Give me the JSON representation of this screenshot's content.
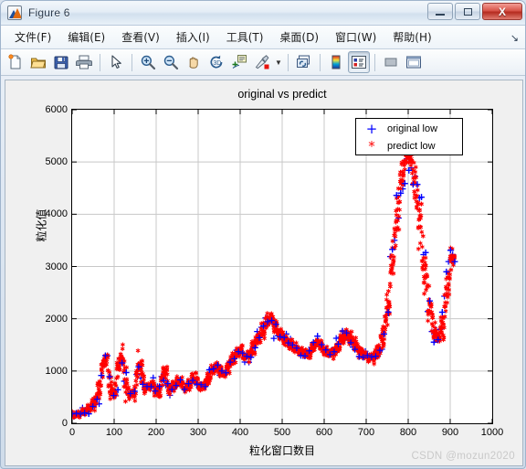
{
  "window": {
    "title": "Figure 6",
    "icon": "matlab-membrane-icon",
    "controls": {
      "minimize": "–",
      "maximize": "□",
      "close": "X"
    }
  },
  "menu": {
    "items": [
      {
        "label": "文件(F)",
        "name": "menu-file"
      },
      {
        "label": "编辑(E)",
        "name": "menu-edit"
      },
      {
        "label": "查看(V)",
        "name": "menu-view"
      },
      {
        "label": "插入(I)",
        "name": "menu-insert"
      },
      {
        "label": "工具(T)",
        "name": "menu-tools"
      },
      {
        "label": "桌面(D)",
        "name": "menu-desktop"
      },
      {
        "label": "窗口(W)",
        "name": "menu-window"
      },
      {
        "label": "帮助(H)",
        "name": "menu-help"
      }
    ],
    "overflow": "↘"
  },
  "toolbar": {
    "buttons": [
      "new-figure-icon",
      "open-file-icon",
      "save-figure-icon",
      "print-figure-icon",
      "pointer-icon",
      "zoom-in-icon",
      "zoom-out-icon",
      "pan-icon",
      "rotate-3d-icon",
      "data-cursor-icon",
      "brush-icon",
      "brush-dropdown-arrow",
      "link-plot-icon",
      "colorbar-icon",
      "legend-icon",
      "hide-plot-tools-icon",
      "show-plot-tools-icon"
    ],
    "pressed": "legend-icon"
  },
  "watermark": "CSDN @mozun2020",
  "chart_data": {
    "type": "scatter",
    "title": "original vs predict",
    "xlabel": "粒化窗口数目",
    "ylabel": "粒化值",
    "xlim": [
      0,
      1000
    ],
    "ylim": [
      0,
      6000
    ],
    "xticks": [
      0,
      100,
      200,
      300,
      400,
      500,
      600,
      700,
      800,
      900,
      1000
    ],
    "yticks": [
      0,
      1000,
      2000,
      3000,
      4000,
      5000,
      6000
    ],
    "grid": true,
    "legend": {
      "position": "top-right-inside",
      "entries": [
        {
          "name": "original low",
          "marker": "+",
          "color": "#0000ff"
        },
        {
          "name": "predict low",
          "marker": "*",
          "color": "#ff0000"
        }
      ]
    },
    "series": [
      {
        "name": "original low",
        "marker": "+",
        "color": "#0000ff",
        "note": "sparse blue plus markers drawn over the red series",
        "stride": 9
      },
      {
        "name": "predict low",
        "marker": "*",
        "color": "#ff0000",
        "note": "dense red asterisk markers covering the full x range",
        "stride": 1
      }
    ],
    "x": [
      0,
      5,
      10,
      15,
      20,
      25,
      30,
      35,
      40,
      45,
      50,
      55,
      60,
      65,
      70,
      75,
      80,
      85,
      90,
      95,
      100,
      105,
      110,
      115,
      120,
      125,
      130,
      135,
      140,
      145,
      150,
      155,
      160,
      165,
      170,
      175,
      180,
      185,
      190,
      195,
      200,
      205,
      210,
      215,
      220,
      225,
      230,
      235,
      240,
      245,
      250,
      255,
      260,
      265,
      270,
      275,
      280,
      285,
      290,
      295,
      300,
      305,
      310,
      315,
      320,
      325,
      330,
      335,
      340,
      345,
      350,
      355,
      360,
      365,
      370,
      375,
      380,
      385,
      390,
      395,
      400,
      405,
      410,
      415,
      420,
      425,
      430,
      435,
      440,
      445,
      450,
      455,
      460,
      465,
      470,
      475,
      480,
      485,
      490,
      495,
      500,
      505,
      510,
      515,
      520,
      525,
      530,
      535,
      540,
      545,
      550,
      555,
      560,
      565,
      570,
      575,
      580,
      585,
      590,
      595,
      600,
      605,
      610,
      615,
      620,
      625,
      630,
      635,
      640,
      645,
      650,
      655,
      660,
      665,
      670,
      675,
      680,
      685,
      690,
      695,
      700,
      705,
      710,
      715,
      720,
      725,
      730,
      735,
      740,
      745,
      750,
      755,
      760,
      765,
      770,
      775,
      780,
      785,
      790,
      795,
      800,
      805,
      810,
      815,
      820,
      825,
      830,
      835,
      840,
      845,
      850,
      855,
      860,
      865,
      870,
      875,
      880,
      885,
      890,
      895,
      900,
      905,
      910,
      915,
      920
    ],
    "y": [
      160,
      150,
      170,
      180,
      200,
      210,
      230,
      250,
      280,
      320,
      360,
      430,
      520,
      680,
      900,
      1150,
      1280,
      1050,
      800,
      620,
      560,
      760,
      1080,
      1290,
      1210,
      980,
      700,
      520,
      600,
      560,
      640,
      900,
      1180,
      1010,
      780,
      690,
      700,
      720,
      760,
      700,
      620,
      560,
      700,
      850,
      1010,
      860,
      700,
      660,
      690,
      730,
      780,
      820,
      760,
      700,
      660,
      700,
      760,
      820,
      880,
      840,
      760,
      700,
      680,
      720,
      800,
      880,
      960,
      1020,
      1060,
      1080,
      1040,
      980,
      940,
      980,
      1060,
      1140,
      1200,
      1260,
      1300,
      1350,
      1400,
      1360,
      1300,
      1260,
      1290,
      1340,
      1420,
      1500,
      1560,
      1620,
      1700,
      1780,
      1860,
      1940,
      2010,
      1980,
      1900,
      1820,
      1760,
      1700,
      1660,
      1620,
      1580,
      1540,
      1500,
      1460,
      1440,
      1420,
      1400,
      1380,
      1360,
      1340,
      1330,
      1340,
      1380,
      1450,
      1520,
      1560,
      1520,
      1460,
      1400,
      1360,
      1340,
      1330,
      1340,
      1380,
      1440,
      1500,
      1560,
      1620,
      1680,
      1700,
      1660,
      1600,
      1540,
      1480,
      1420,
      1380,
      1340,
      1300,
      1280,
      1260,
      1250,
      1260,
      1290,
      1340,
      1420,
      1530,
      1680,
      1880,
      2150,
      2480,
      2850,
      3250,
      3650,
      4050,
      4400,
      4700,
      4920,
      5080,
      5150,
      5080,
      4900,
      4650,
      4350,
      4000,
      3620,
      3250,
      2900,
      2580,
      2300,
      2050,
      1850,
      1700,
      1620,
      1660,
      1800,
      2050,
      2380,
      2720,
      3000,
      3180,
      3230,
      3100
    ]
  }
}
